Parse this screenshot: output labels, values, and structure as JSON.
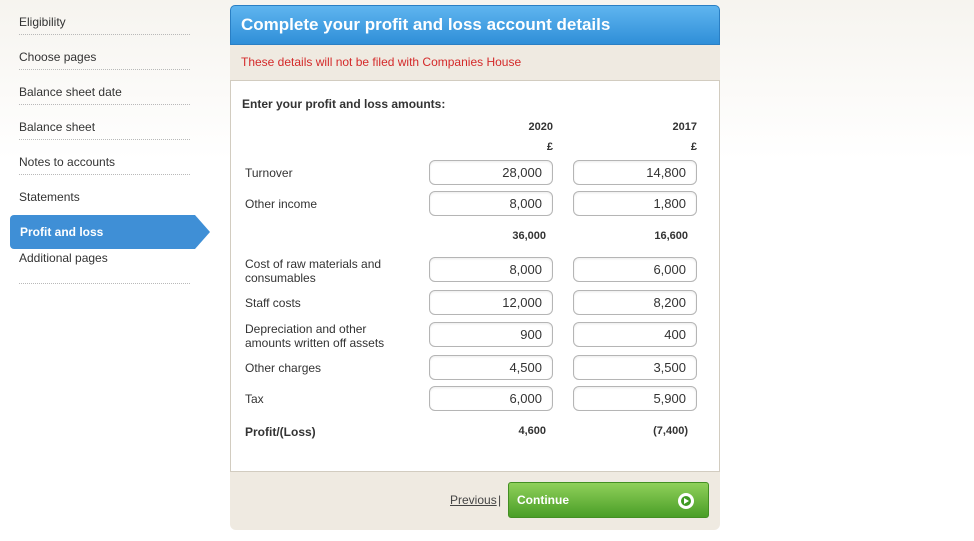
{
  "sidebar": {
    "items": [
      {
        "label": "Eligibility"
      },
      {
        "label": "Choose pages"
      },
      {
        "label": "Balance sheet date"
      },
      {
        "label": "Balance sheet"
      },
      {
        "label": "Notes to accounts"
      },
      {
        "label": "Statements"
      },
      {
        "label": "Profit and loss",
        "active": true
      },
      {
        "label": "Additional pages"
      }
    ]
  },
  "panel": {
    "title": "Complete your profit and loss account details",
    "notice": "These details will not be filed with Companies House",
    "prompt": "Enter your profit and loss amounts:",
    "columns": [
      {
        "year": "2020",
        "currency": "£"
      },
      {
        "year": "2017",
        "currency": "£"
      }
    ],
    "rows": {
      "turnover": {
        "label": "Turnover",
        "y2020": "28,000",
        "y2017": "14,800"
      },
      "other_income": {
        "label": "Other income",
        "y2020": "8,000",
        "y2017": "1,800"
      },
      "subtotal": {
        "y2020": "36,000",
        "y2017": "16,600"
      },
      "raw_materials": {
        "label": "Cost of raw materials and consumables",
        "y2020": "8,000",
        "y2017": "6,000"
      },
      "staff_costs": {
        "label": "Staff costs",
        "y2020": "12,000",
        "y2017": "8,200"
      },
      "depreciation": {
        "label": "Depreciation and other amounts written off assets",
        "y2020": "900",
        "y2017": "400"
      },
      "other_charges": {
        "label": "Other charges",
        "y2020": "4,500",
        "y2017": "3,500"
      },
      "tax": {
        "label": "Tax",
        "y2020": "6,000",
        "y2017": "5,900"
      },
      "profit": {
        "label": "Profit/(Loss)",
        "y2020": "4,600",
        "y2017": "(7,400)"
      }
    }
  },
  "footer": {
    "previous_label": "Previous",
    "separator": "|",
    "continue_label": "Continue"
  },
  "colors": {
    "accent_blue": "#3f8fd6",
    "notice_red": "#d42a2a",
    "continue_green": "#4a9e27"
  }
}
